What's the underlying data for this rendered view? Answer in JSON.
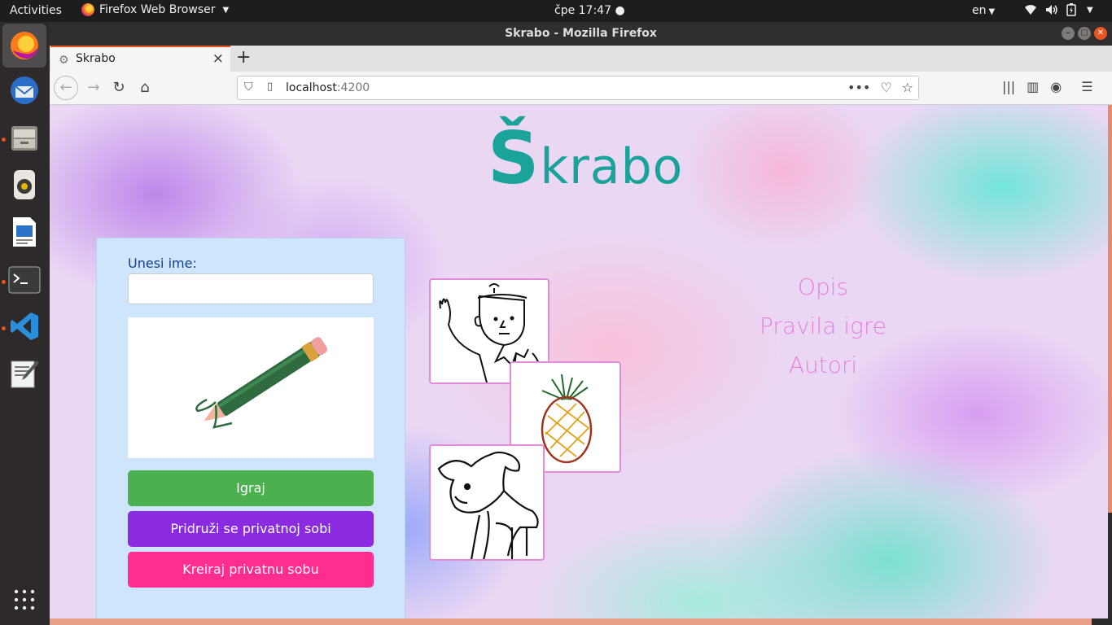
{
  "topbar": {
    "activities": "Activities",
    "app_name": "Firefox Web Browser",
    "clock": "čpe 17:47",
    "lang": "en"
  },
  "window": {
    "title": "Skrabo - Mozilla Firefox"
  },
  "tab": {
    "title": "Skrabo"
  },
  "url": {
    "host": "localhost",
    "port": ":4200"
  },
  "page": {
    "logo_s": "Š",
    "logo_rest": "krabo",
    "name_label": "Unesi ime:",
    "name_value": "",
    "buttons": {
      "play": "Igraj",
      "join": "Pridruži se privatnoj sobi",
      "create": "Kreiraj privatnu sobu"
    },
    "menu": [
      "Opis",
      "Pravila igre",
      "Autori"
    ]
  },
  "colors": {
    "logo": "#1aa39a",
    "play": "#4caf50",
    "join": "#8a2be2",
    "create": "#ff2d8e",
    "menu": "#ea7fe0",
    "card_bg": "#cfe5fc"
  }
}
